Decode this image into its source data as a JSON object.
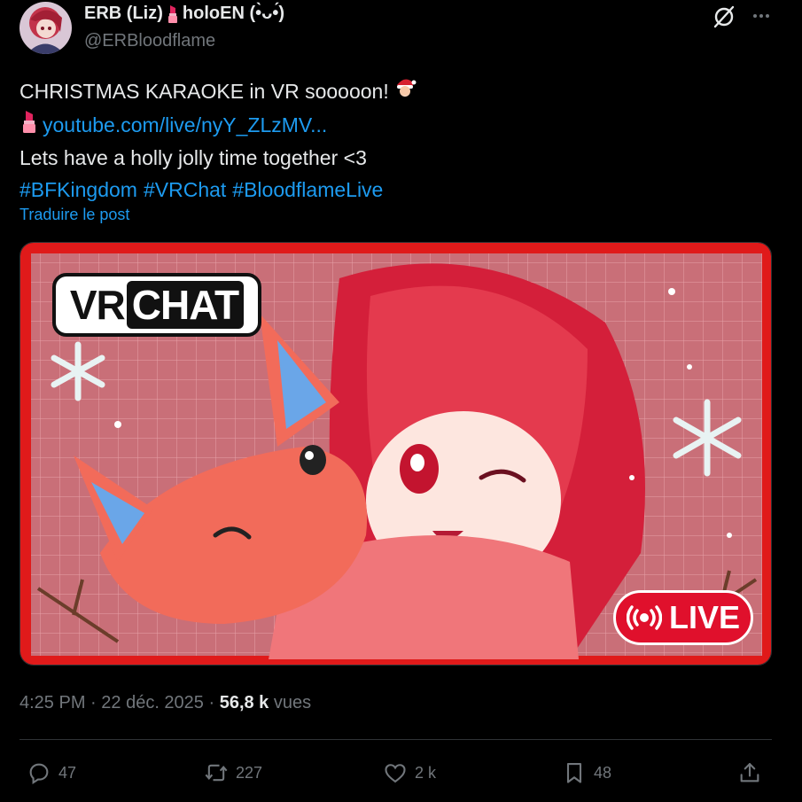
{
  "author": {
    "display_name_part1": "ERB (Liz)",
    "display_name_part2": "holoEN (•̀ᴗ•́)",
    "handle": "@ERBloodflame"
  },
  "tweet": {
    "line1": "CHRISTMAS KARAOKE in VR sooooon!",
    "link": "youtube.com/live/nyY_ZLzMV...",
    "line3": "Lets have a holly jolly time together <3",
    "hashtags": [
      "#BFKingdom",
      "#VRChat",
      "#BloodflameLive"
    ],
    "translate": "Traduire le post"
  },
  "media": {
    "vrchat_label_a": "VR",
    "vrchat_label_b": "CHAT",
    "live_label": "LIVE"
  },
  "meta": {
    "time": "4:25 PM",
    "date": "22 déc. 2025",
    "views_count": "56,8 k",
    "views_label": "vues"
  },
  "actions": {
    "replies": "47",
    "reposts": "227",
    "likes": "2 k",
    "bookmarks": "48"
  },
  "colors": {
    "accent": "#1d9bf0",
    "text": "#e7e9ea",
    "muted": "#71767b",
    "live_red": "#e0102c"
  }
}
